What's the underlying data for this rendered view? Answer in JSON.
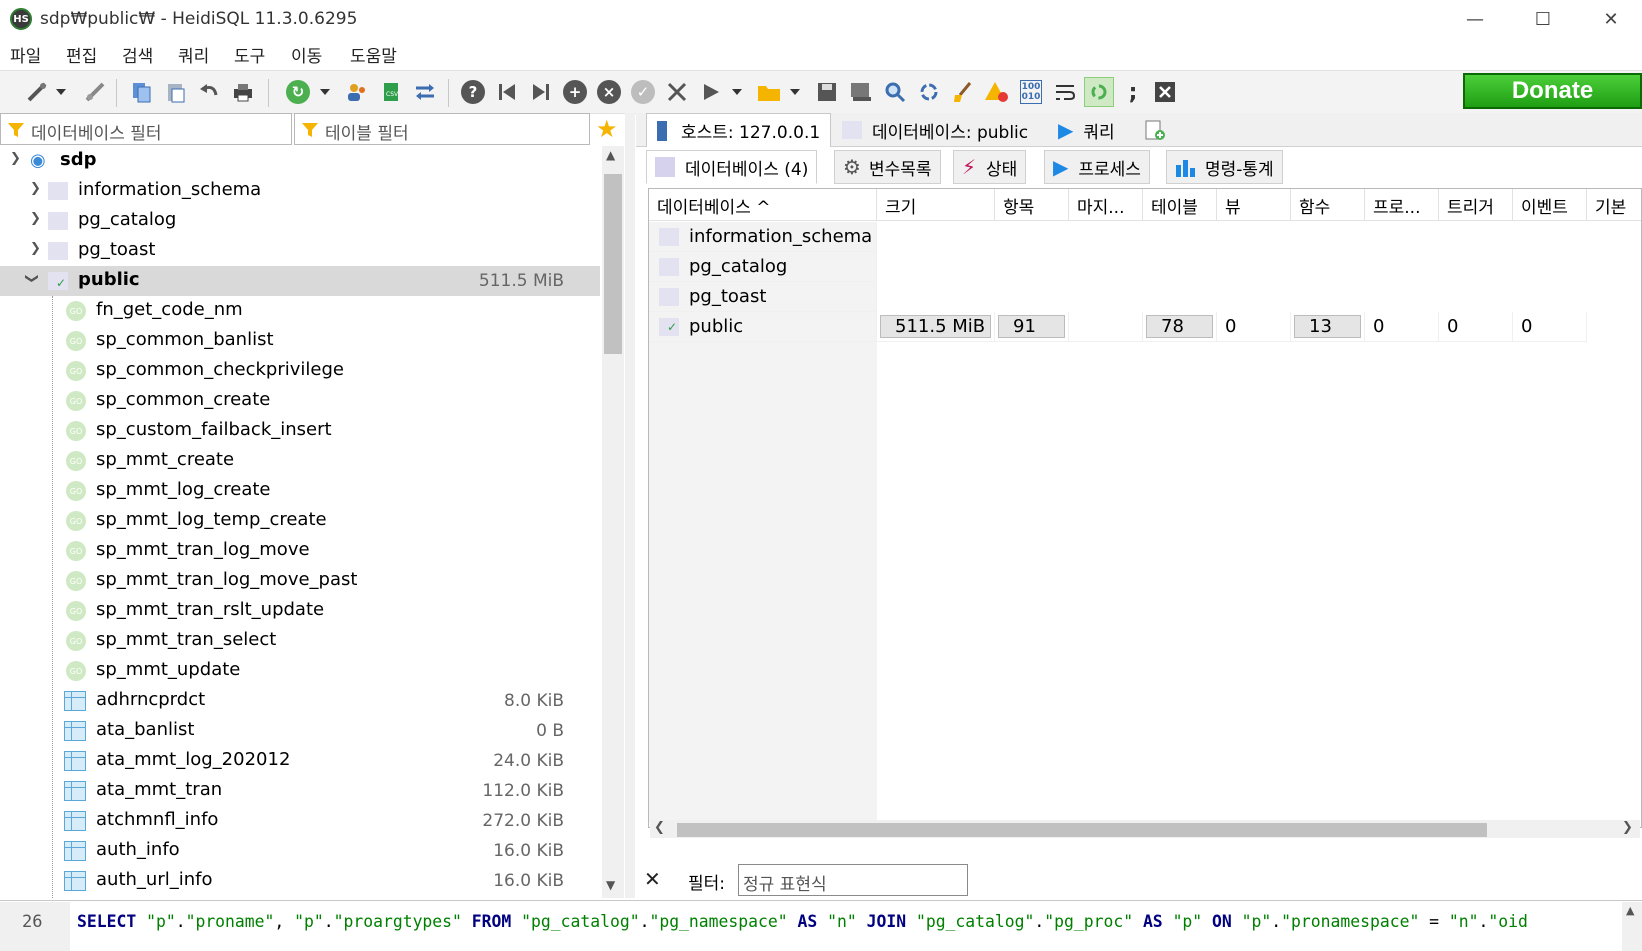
{
  "window": {
    "title": "sdp₩public₩ - HeidiSQL 11.3.0.6295",
    "icon_text": "HS",
    "controls": [
      "minimize-icon",
      "maximize-icon",
      "close-icon"
    ]
  },
  "menu": [
    "파일",
    "편집",
    "검색",
    "쿼리",
    "도구",
    "이동",
    "도움말"
  ],
  "toolbar": {
    "donate_label": "Donate",
    "icons": [
      "connect-icon",
      "dropdown-arrow-icon",
      "disconnect-icon",
      "copy-icon",
      "paste-icon",
      "undo-icon",
      "print-icon",
      "refresh-icon",
      "dropdown-arrow-icon",
      "user-manager-icon",
      "export-icon",
      "sync-icon",
      "help-icon",
      "first-icon",
      "last-icon",
      "add-icon",
      "remove-icon",
      "apply-icon",
      "cancel-icon",
      "run-icon",
      "dropdown-arrow-icon",
      "open-folder-icon",
      "dropdown-arrow-icon",
      "save-icon",
      "save-as-icon",
      "find-icon",
      "replace-icon",
      "clear-icon",
      "warning-icon",
      "binary-icon",
      "wrap-icon",
      "auto-refresh-icon",
      "terminator-icon",
      "close-tab-icon"
    ]
  },
  "filters": {
    "db_filter": "데이터베이스 필터",
    "table_filter": "테이블 필터"
  },
  "tree": {
    "root": "sdp",
    "databases": [
      {
        "name": "information_schema"
      },
      {
        "name": "pg_catalog"
      },
      {
        "name": "pg_toast"
      },
      {
        "name": "public",
        "size": "511.5 MiB"
      }
    ],
    "functions": [
      "fn_get_code_nm",
      "sp_common_banlist",
      "sp_common_checkprivilege",
      "sp_common_create",
      "sp_custom_failback_insert",
      "sp_mmt_create",
      "sp_mmt_log_create",
      "sp_mmt_log_temp_create",
      "sp_mmt_tran_log_move",
      "sp_mmt_tran_log_move_past",
      "sp_mmt_tran_rslt_update",
      "sp_mmt_tran_select",
      "sp_mmt_update"
    ],
    "tables": [
      {
        "name": "adhrncprdct",
        "size": "8.0 KiB"
      },
      {
        "name": "ata_banlist",
        "size": "0 B"
      },
      {
        "name": "ata_mmt_log_202012",
        "size": "24.0 KiB"
      },
      {
        "name": "ata_mmt_tran",
        "size": "112.0 KiB"
      },
      {
        "name": "atchmnfl_info",
        "size": "272.0 KiB"
      },
      {
        "name": "auth_info",
        "size": "16.0 KiB"
      },
      {
        "name": "auth_url_info",
        "size": "16.0 KiB"
      }
    ]
  },
  "main_tabs": [
    {
      "label": "호스트: 127.0.0.1"
    },
    {
      "label": "데이터베이스: public"
    },
    {
      "label": "쿼리"
    }
  ],
  "sub_tabs": [
    {
      "label": "데이터베이스 (4)"
    },
    {
      "label": "변수목록"
    },
    {
      "label": "상태"
    },
    {
      "label": "프로세스"
    },
    {
      "label": "명령-통계"
    }
  ],
  "grid": {
    "headers": [
      "데이터베이스 ^",
      "크기",
      "항목",
      "마지...",
      "테이블",
      "뷰",
      "함수",
      "프로...",
      "트리거",
      "이벤트",
      "기본"
    ],
    "rows": [
      {
        "name": "information_schema"
      },
      {
        "name": "pg_catalog"
      },
      {
        "name": "pg_toast"
      },
      {
        "name": "public",
        "size": "511.5 MiB",
        "items": "91",
        "tables": "78",
        "views": "0",
        "functions": "13",
        "procedures": "0",
        "triggers": "0",
        "events": "0"
      }
    ]
  },
  "filterbar": {
    "label": "필터:",
    "placeholder": "정규 표현식"
  },
  "editor": {
    "line_number": "26",
    "sql": "SELECT \"p\".\"proname\", \"p\".\"proargtypes\" FROM \"pg_catalog\".\"pg_namespace\" AS \"n\" JOIN \"pg_catalog\".\"pg_proc\" AS \"p\" ON \"p\".\"pronamespace\" = \"n\".\"oid"
  }
}
